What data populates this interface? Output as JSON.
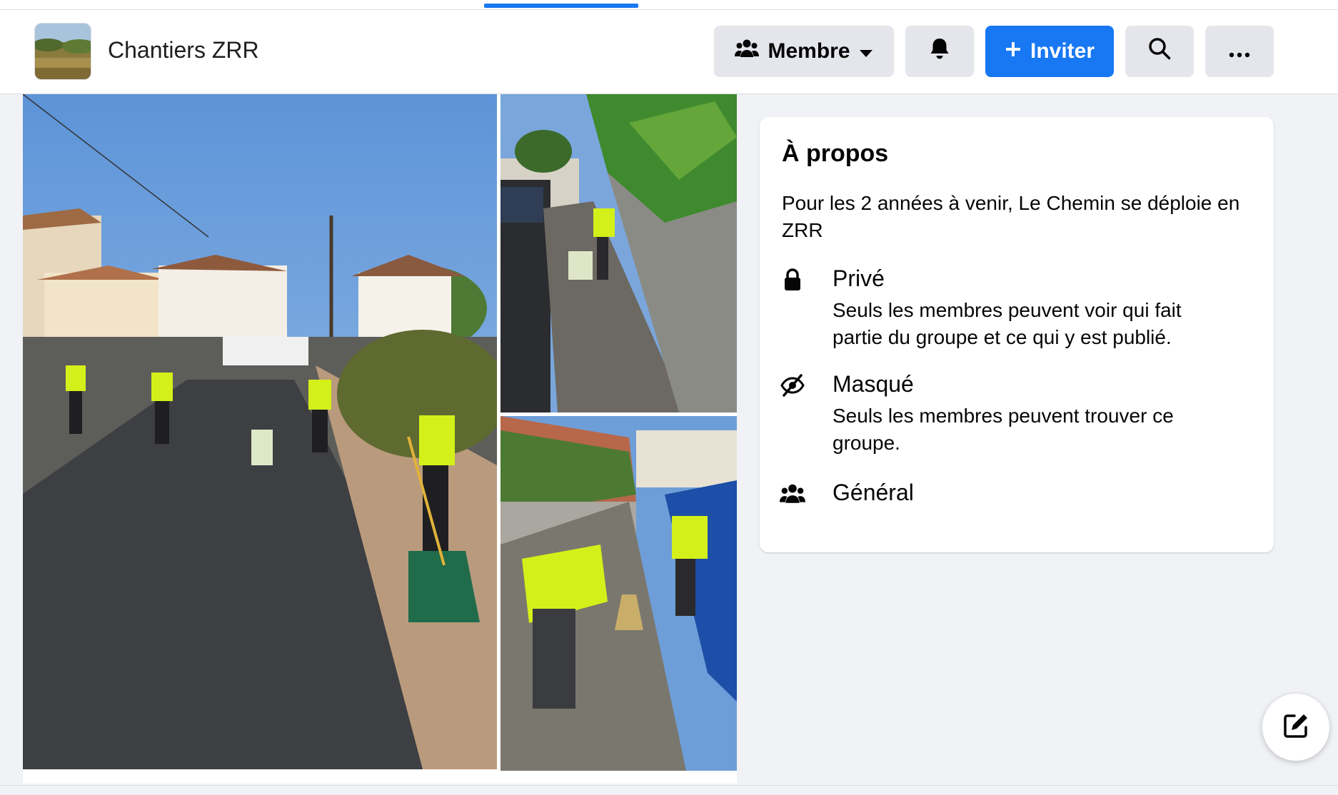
{
  "header": {
    "group_name": "Chantiers ZRR",
    "member_button": "Membre",
    "invite_button": "Inviter"
  },
  "about": {
    "title": "À propos",
    "description": "Pour les 2 années à venir, Le Chemin se déploie en ZRR",
    "privacy_title": "Privé",
    "privacy_desc": "Seuls les membres peuvent voir qui fait partie du groupe et ce qui y est publié.",
    "visibility_title": "Masqué",
    "visibility_desc": "Seuls les membres peuvent trouver ce groupe.",
    "type_title": "Général"
  },
  "icons": {
    "member": "people-icon",
    "dropdown": "caret-down-icon",
    "bell": "bell-icon",
    "invite": "plus-icon",
    "search": "search-icon",
    "more": "ellipsis-icon",
    "lock": "lock-icon",
    "hidden": "eye-slash-icon",
    "general": "people-icon",
    "compose": "edit-icon"
  },
  "colors": {
    "accent": "#1877f2",
    "background": "#f0f2f5",
    "button_gray": "#e4e6eb"
  }
}
